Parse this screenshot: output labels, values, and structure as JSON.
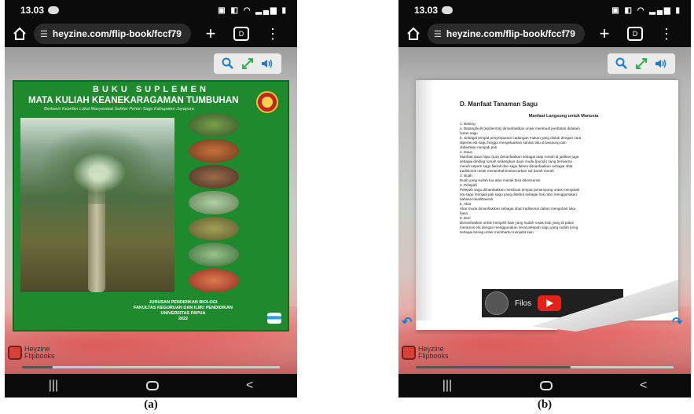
{
  "figure_a": {
    "status": {
      "time": "13.03"
    },
    "browser": {
      "url": "heyzine.com/flip-book/fccf79"
    },
    "cover": {
      "series": "BUKU SUPLEMEN",
      "title": "MATA KULIAH KEANEKARAGAMAN TUMBUHAN",
      "subtitle": "Berbasis Kearifan Lokal Masyarakat Sekitar Pohon Sagu Kabupaten Jayapura",
      "footer_line1": "JURUSAN PENDIDIKAN BIOLOGI",
      "footer_line2": "FAKULTAS KEGURUAN DAN ILMU PENDIDIKAN",
      "footer_line3": "UNIVERSITAS PAPUA",
      "footer_year": "2022"
    },
    "brand": {
      "line1": "Heyzine",
      "line2": "Flipbooks"
    },
    "progress": 0.12,
    "caption": "(a)"
  },
  "figure_b": {
    "status": {
      "time": "13.03"
    },
    "browser": {
      "url": "heyzine.com/flip-book/fccf79"
    },
    "document": {
      "heading": "D. Manfaat Tanaman Sagu",
      "subheading": "Manfaat Langsung untuk Manusia",
      "lines": [
        "1.  Batang",
        "a.  Batang/kulit (epidermis) dimanfaatkan untuk membuat jembatan didalam",
        "     hutan sagu",
        "b.  Sebagai tempat penyimpanan cadangan makan yang diolah dengan cara",
        "     diperas ela sagu hingga mengeluarkan santan lalu di tampung dan",
        "     didiamkan menjadi pati",
        "2.  Daun",
        "     Manfaat daun hijau (tua) dimanfaatkan sebagai atap rumah di jadikan juga",
        "     sebagai dinding rumah sedangkan daun muda (pucuk) yang berwarna",
        "     merah seperti sagu fakrait dan sagu fabien dimanfaatkan sebagai obat",
        "     tradisional untuk menambah/melancarkan sel darah merah",
        "3.  Buah",
        "     Buah yang sudah tua atau masak bisa dikonsumsi",
        "4.  Pelepah",
        "     Pelepah sagu dimanfaatkan membuat tempat penampung untuk mengolah",
        "     ela sagu menjadi pati sagu yang disebut sebagai hak rabo menggunakan",
        "     bahasa lokal/Daerah",
        "5.  Akar",
        "     Akar muda dimanfaatkan sebagai obat tradisional dalam mengobati luka",
        "     basa",
        "6.  Duri",
        "     Dimanfaatkan untuk menjahit kain yang sudah rusak kain yang di pakai",
        "     meramas ela dengan menggunakan serat pelepah sagu yang sudah kring",
        "     sebagai benag untuk membantu menjahit kain"
      ],
      "video_title": "Filos"
    },
    "brand": {
      "line1": "Heyzine",
      "line2": "Flipbooks"
    },
    "progress": 0.6,
    "caption": "(b)"
  },
  "colors": {
    "cover_green": "#1e8a2d",
    "accent_blue": "#1b7bd0",
    "brand_red": "#d9403a"
  },
  "icons": {
    "toolbar": [
      "search-icon",
      "fullscreen-icon",
      "sound-icon"
    ],
    "nav": [
      "recent-apps-icon",
      "home-icon",
      "back-icon"
    ]
  }
}
